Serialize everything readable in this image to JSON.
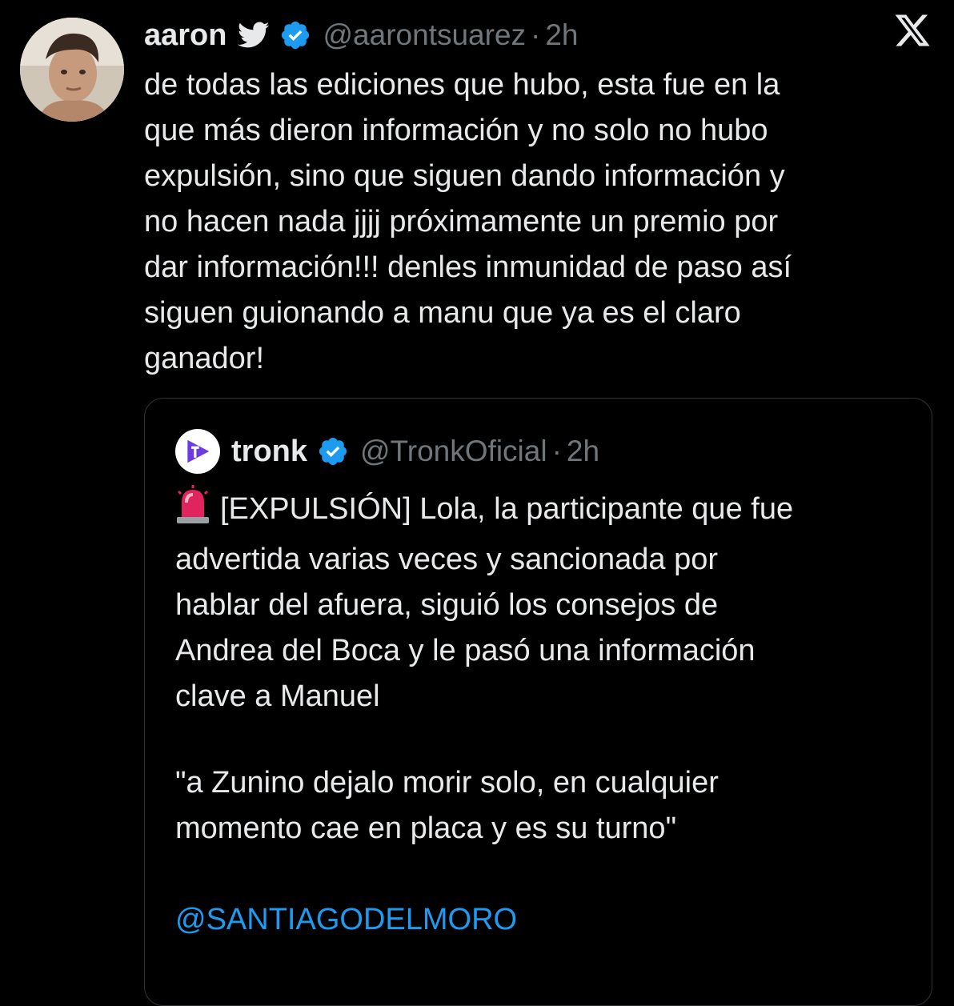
{
  "tweet": {
    "author_name": "aaron",
    "handle": "@aarontsuarez",
    "separator": "·",
    "time": "2h",
    "text": "de todas las ediciones que hubo, esta fue en la\nque más dieron información y no solo no hubo\nexpulsión, sino que siguen dando información y\nno hacen nada jjjj próximamente un premio por\ndar información!!! denles inmunidad de paso así\nsiguen guionando a manu que ya es el claro\nganador!"
  },
  "quoted_tweet": {
    "author_name": "tronk",
    "handle": "@TronkOficial",
    "separator": "·",
    "time": "2h",
    "text": "[EXPULSIÓN] Lola, la participante que fue\nadvertida varias veces y sancionada por\nhablar del afuera, siguió los consejos de\nAndrea del Boca y le pasó una información\nclave a Manuel",
    "quote_text": "\"a Zunino dejalo morir solo, en cualquier\nmomento cae en placa y es su turno\"",
    "mention": "@SANTIAGODELMORO"
  },
  "icons": {
    "bird": "twitter-bird-icon",
    "verified": "verified-badge-icon",
    "x_logo": "x-logo-icon",
    "siren": "siren-emoji-icon",
    "tronk_logo": "tronk-logo-icon"
  },
  "colors": {
    "background": "#000000",
    "text": "#e7e9ea",
    "secondary": "#71767b",
    "link": "#1d9bf0",
    "verified": "#1d9bf0",
    "border": "#2f3336",
    "tronk_brand": "#6c3ce0"
  }
}
